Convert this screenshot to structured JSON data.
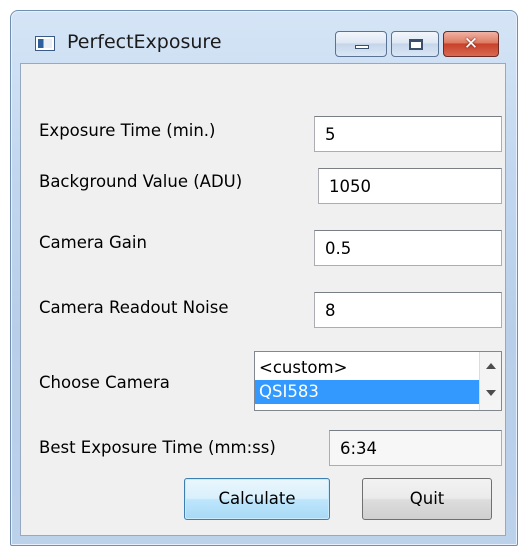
{
  "window": {
    "title": "PerfectExposure",
    "controls": {
      "minimize": "minimize",
      "maximize": "maximize",
      "close": "close"
    }
  },
  "form": {
    "exposure_time": {
      "label": "Exposure Time (min.)",
      "value": "5"
    },
    "background_value": {
      "label": "Background Value (ADU)",
      "value": "1050"
    },
    "camera_gain": {
      "label": "Camera Gain",
      "value": "0.5"
    },
    "readout_noise": {
      "label": "Camera Readout Noise",
      "value": "8"
    },
    "camera": {
      "label": "Choose Camera",
      "options": [
        "<custom>",
        "QSI583"
      ],
      "selected": "QSI583"
    },
    "best_exposure": {
      "label": "Best Exposure Time (mm:ss)",
      "value": "6:34"
    }
  },
  "buttons": {
    "calculate": "Calculate",
    "quit": "Quit"
  },
  "colors": {
    "selection": "#3399ff",
    "close_button": "#c9402a",
    "titlebar": "#c2d7ef"
  }
}
